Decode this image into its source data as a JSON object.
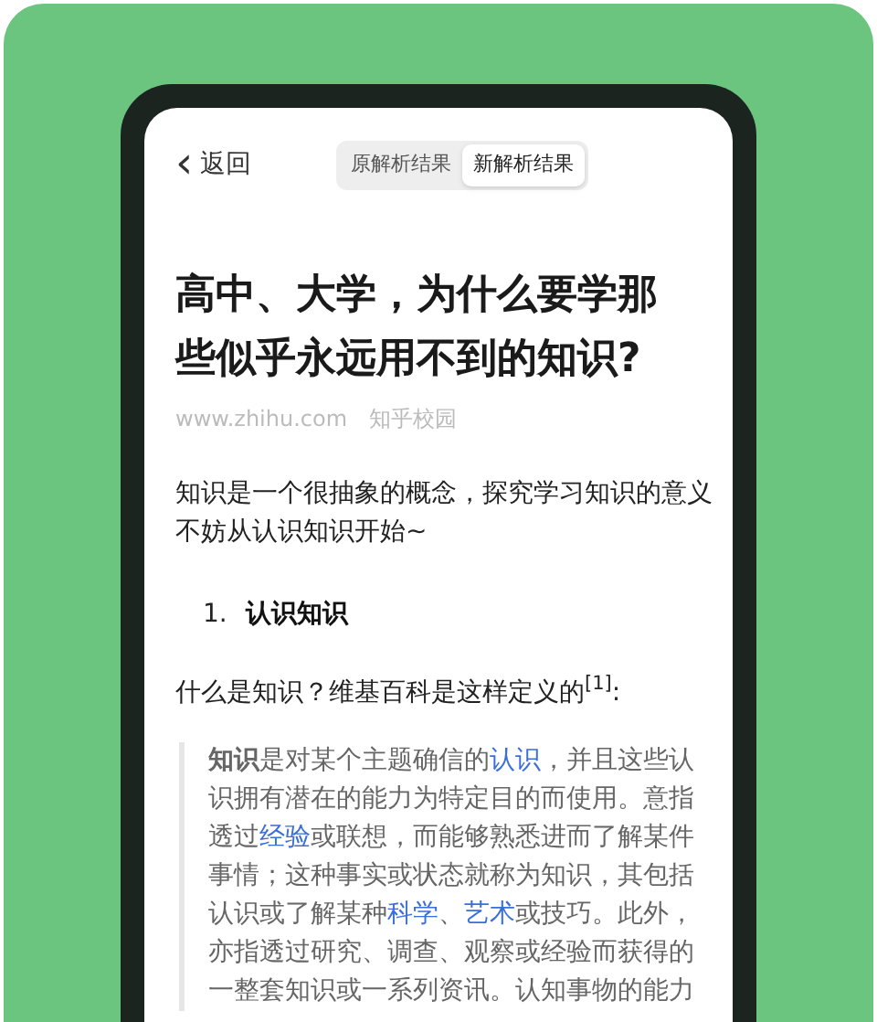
{
  "header": {
    "back": {
      "icon": "‹",
      "label": "返回"
    },
    "tabs": [
      {
        "label": "原解析结果",
        "selected": false
      },
      {
        "label": "新解析结果",
        "selected": true
      }
    ]
  },
  "article": {
    "title": "高中、大学，为什么要学那些似乎永远用不到的知识?",
    "source": {
      "site": "www.zhihu.com",
      "author": "知乎校园"
    },
    "intro": "知识是一个很抽象的概念，探究学习知识的意义不妨从认识知识开始~",
    "list": [
      {
        "number": "1.",
        "text": "认识知识"
      }
    ],
    "question": "什么是知识？维基百科是这样定义的$^{[1]}$:",
    "quote": [
      {
        "kind": "text",
        "text": "**知识**是对某个主题确信的"
      },
      {
        "kind": "link",
        "text": "认识"
      },
      {
        "kind": "text",
        "text": "，并且这些认识拥有潜在的能力为特定目的而使用。意指透过"
      },
      {
        "kind": "link",
        "text": "经验"
      },
      {
        "kind": "text",
        "text": "或联想，而能够熟悉进而了解某件事情；这种事实或状态就称为知识，其包括认识或了解某种"
      },
      {
        "kind": "link",
        "text": "科学"
      },
      {
        "kind": "text",
        "text": "、"
      },
      {
        "kind": "link",
        "text": "艺术"
      },
      {
        "kind": "text",
        "text": "或技巧。此外，亦指透过研究、调查、观察或经验而获得的一整套知识或一系列资讯。认知事物的能力"
      }
    ]
  }
}
